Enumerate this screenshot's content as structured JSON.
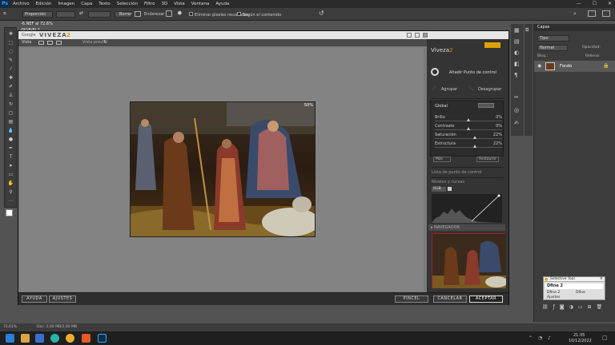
{
  "app": {
    "logo": "Ps"
  },
  "menu": [
    "Archivo",
    "Edición",
    "Imagen",
    "Capa",
    "Texto",
    "Selección",
    "Filtro",
    "3D",
    "Vista",
    "Ventana",
    "Ayuda"
  ],
  "window_controls": [
    "—",
    "☐",
    "✕"
  ],
  "options_bar": {
    "style_value": "Proporción",
    "swap_icon": "⇄",
    "clear_label": "Borrar",
    "straighten_label": "Enderezar",
    "delete_cropped_label": "Eliminar píxeles recortados",
    "content_aware_label": "Según el contenido"
  },
  "document_tab": {
    "title": "-6.NEF al 72,6% (RGB/8) *"
  },
  "plugin": {
    "brand_google": "Google",
    "brand_name": "VIVEZA",
    "brand_suffix": "2",
    "view_label": "Vista",
    "preview_label": "Vista previa",
    "zoom_badge": "50%",
    "side_title": "Viveza",
    "side_title_num": "2",
    "add_control_point": "Añadir Punto de control",
    "group_label": "Agrupar",
    "ungroup_label": "Desagrupar",
    "global_label": "Global",
    "sliders": [
      {
        "label": "Brillo",
        "value": "0%"
      },
      {
        "label": "Contraste",
        "value": "0%"
      },
      {
        "label": "Saturación",
        "value": "22%"
      },
      {
        "label": "Estructura",
        "value": "22%"
      }
    ],
    "sliders_level": [
      0.5,
      0.5,
      0.6,
      0.6
    ],
    "more_label": "Más",
    "reset_label": "Restaurar",
    "control_points_list": "Lista de punto de control",
    "levels_curves": "Niveles y curvas",
    "rgb_label": "RGB",
    "navigator_label": "▸ NAVEGADOR",
    "help_button": "AYUDA",
    "settings_button": "AJUSTES",
    "brush_button": "PINCEL",
    "cancel_button": "CANCELAR",
    "accept_button": "ACEPTAR"
  },
  "layers_panel": {
    "tab_label": "Capas",
    "kind_placeholder": "Tipo",
    "blend_mode": "Normal",
    "opacity_label": "Opacidad:",
    "lock_label": "Bloq.:",
    "fill_label": "Relleno:",
    "layer_name": "Fondo"
  },
  "selective_tool": {
    "title": "Selective Tool",
    "item1": "Dfine 2",
    "item2": "Dfine 2",
    "item3": "Dfine",
    "item4": "Ajustes"
  },
  "status_bar": {
    "zoom": "72,61%",
    "doc": "Doc: 2,00 MB/2,00 MB"
  },
  "taskbar": {
    "time": "21:35",
    "date": "10/12/2022"
  }
}
